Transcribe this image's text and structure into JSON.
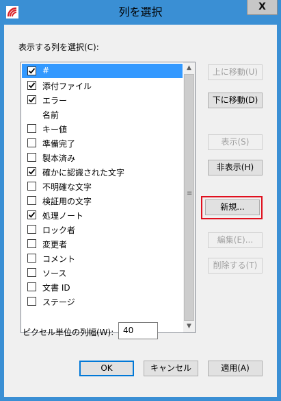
{
  "window": {
    "title": "列を選択",
    "close_glyph": "X",
    "app_icon": "app-logo-icon"
  },
  "list_label": "表示する列を選択(C):",
  "columns": [
    {
      "label": "#",
      "checked": true,
      "selected": true
    },
    {
      "label": "添付ファイル",
      "checked": true,
      "selected": false
    },
    {
      "label": "エラー",
      "checked": true,
      "selected": false
    },
    {
      "label": "名前",
      "checked": null,
      "selected": false
    },
    {
      "label": "キー値",
      "checked": false,
      "selected": false
    },
    {
      "label": "準備完了",
      "checked": false,
      "selected": false
    },
    {
      "label": "製本済み",
      "checked": false,
      "selected": false
    },
    {
      "label": "確かに認識された文字",
      "checked": true,
      "selected": false
    },
    {
      "label": "不明確な文字",
      "checked": false,
      "selected": false
    },
    {
      "label": "検証用の文字",
      "checked": false,
      "selected": false
    },
    {
      "label": "処理ノート",
      "checked": true,
      "selected": false
    },
    {
      "label": "ロック者",
      "checked": false,
      "selected": false
    },
    {
      "label": "変更者",
      "checked": false,
      "selected": false
    },
    {
      "label": "コメント",
      "checked": false,
      "selected": false
    },
    {
      "label": "ソース",
      "checked": false,
      "selected": false
    },
    {
      "label": "文書 ID",
      "checked": false,
      "selected": false
    },
    {
      "label": "ステージ",
      "checked": false,
      "selected": false
    }
  ],
  "side_buttons": {
    "move_up": "上に移動(U)",
    "move_down": "下に移動(D)",
    "show": "表示(S)",
    "hide": "非表示(H)",
    "new": "新規...",
    "edit": "編集(E)...",
    "delete": "削除する(T)"
  },
  "pixel_width": {
    "label": "ピクセル単位の列幅(W):",
    "value": "40"
  },
  "footer_buttons": {
    "ok": "OK",
    "cancel": "キャンセル",
    "apply": "適用(A)"
  },
  "colors": {
    "title_bar": "#3a8fd4",
    "selection": "#3399ff",
    "highlight_box": "#e0101e"
  }
}
